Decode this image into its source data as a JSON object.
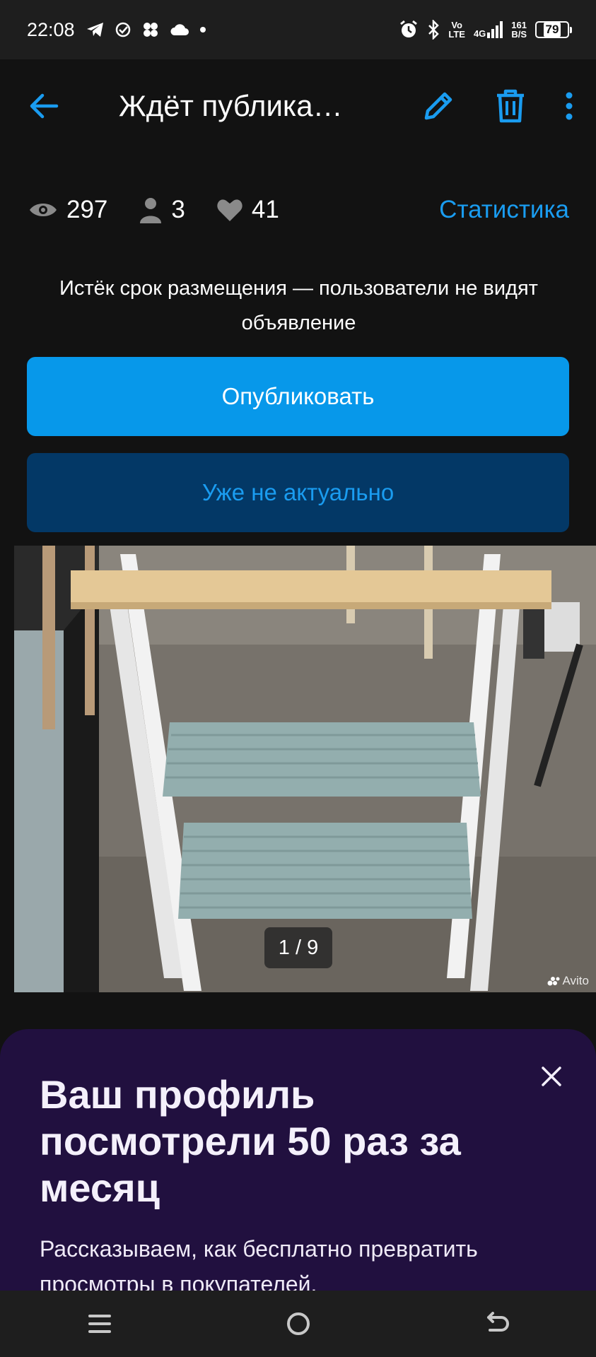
{
  "status_bar": {
    "time": "22:08",
    "network_top": "Vo",
    "network_bottom": "LTE",
    "signal_label": "4G",
    "speed_top": "161",
    "speed_bottom": "B/S",
    "battery": "79"
  },
  "app_bar": {
    "title": "Ждёт публикации",
    "icons": [
      "back-arrow-icon",
      "pencil-icon",
      "trash-icon",
      "more-vertical-icon"
    ],
    "accent_color": "#1a9cf0"
  },
  "stats": {
    "views": "297",
    "contacts": "3",
    "favorites": "41",
    "statistics_link": "Статистика"
  },
  "notice": "Истёк срок размещения — пользователи не видят объявление",
  "buttons": {
    "publish": "Опубликовать",
    "not_relevant": "Уже не актуально"
  },
  "gallery": {
    "counter": "1 / 9",
    "watermark": "Avito"
  },
  "promo": {
    "headline": "Ваш профиль посмотрели 50 раз за месяц",
    "subtitle": "Рассказываем, как бесплатно превратить просмотры в покупателей.",
    "background": "#21103f"
  }
}
